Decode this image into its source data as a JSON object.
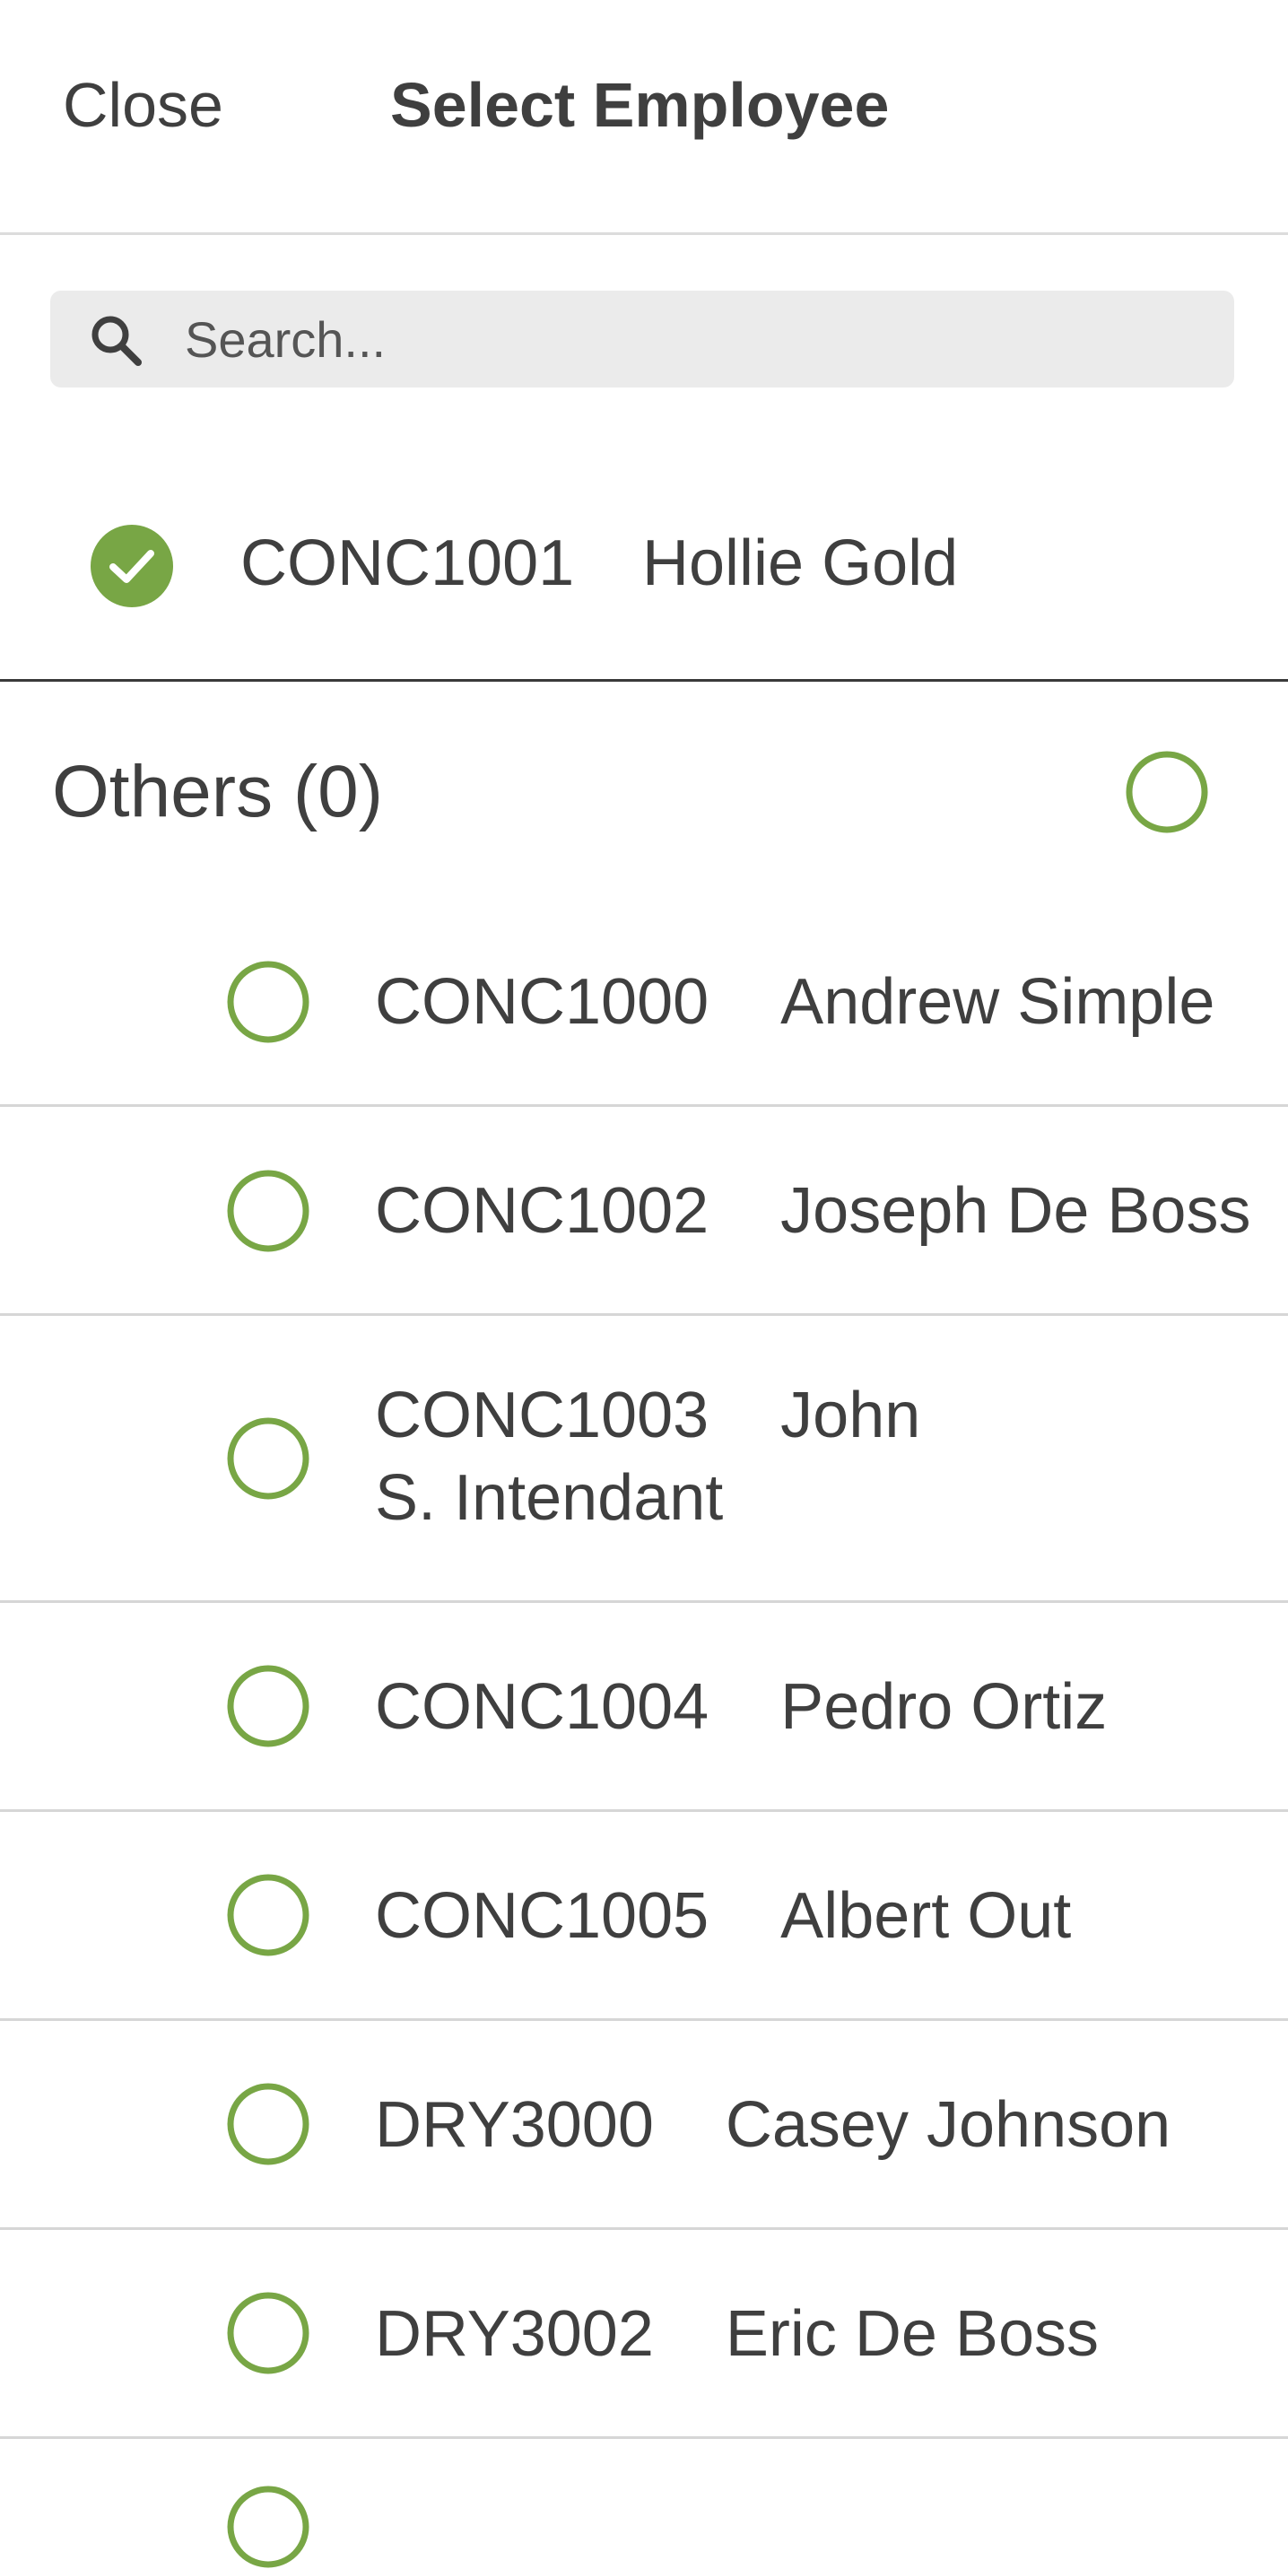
{
  "header": {
    "close_label": "Close",
    "title": "Select Employee"
  },
  "search": {
    "placeholder": "Search...",
    "value": ""
  },
  "selected": {
    "code": "CONC1001",
    "name": "Hollie Gold"
  },
  "others": {
    "title": "Others (0)",
    "items": [
      {
        "code": "CONC1000",
        "name": "Andrew Simple"
      },
      {
        "code": "CONC1002",
        "name": "Joseph De Boss"
      },
      {
        "code": "CONC1003",
        "name": "John S. Intendant"
      },
      {
        "code": "CONC1004",
        "name": "Pedro Ortiz"
      },
      {
        "code": "CONC1005",
        "name": "Albert Out"
      },
      {
        "code": "DRY3000",
        "name": "Casey Johnson"
      },
      {
        "code": "DRY3002",
        "name": "Eric De Boss"
      }
    ]
  },
  "colors": {
    "accent": "#78a645",
    "text": "#3f3f3f",
    "search_bg": "#ebebeb"
  },
  "icons": {
    "search": "search-icon",
    "selected": "check-circle-icon",
    "unselected": "radio-circle-icon"
  }
}
